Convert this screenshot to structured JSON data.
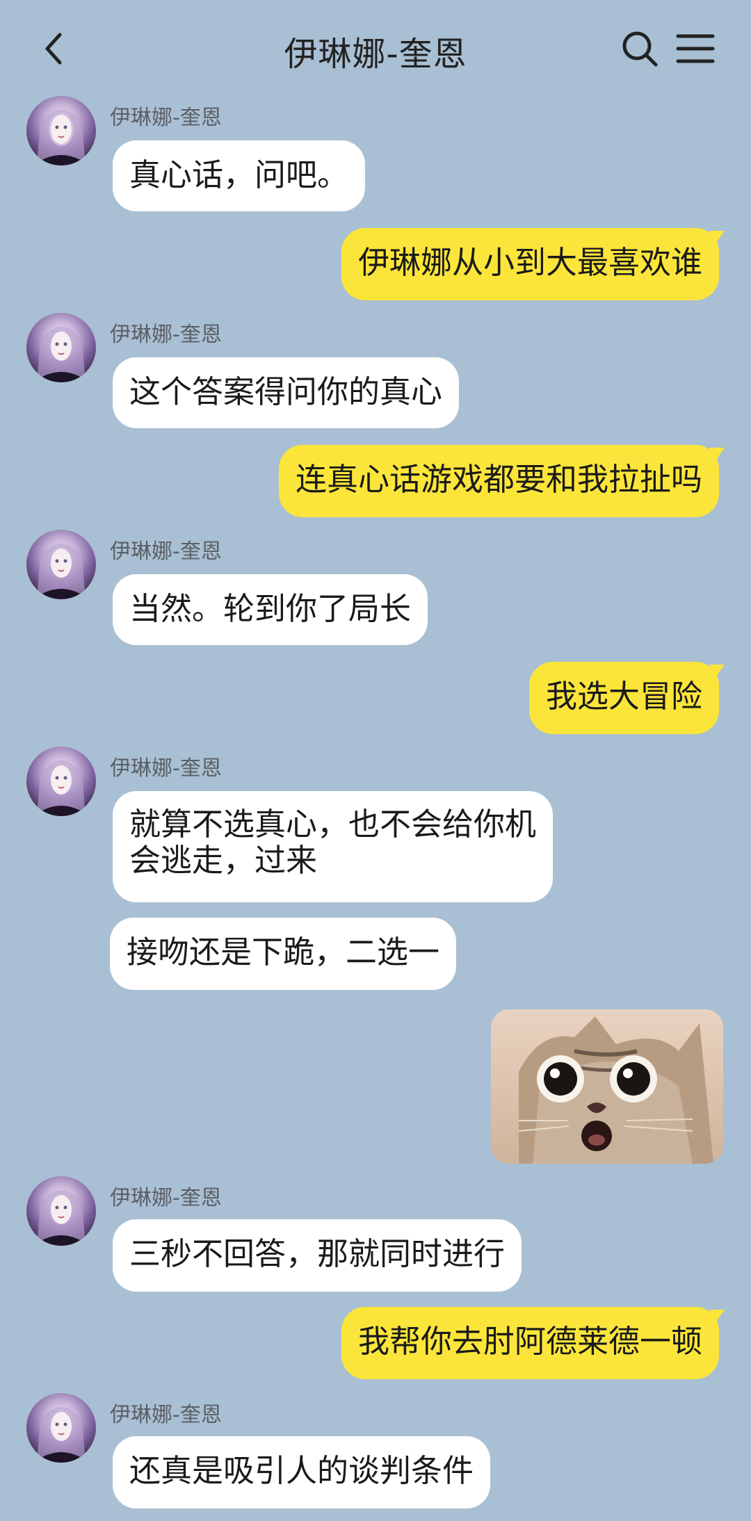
{
  "header": {
    "title": "伊琳娜-奎恩",
    "back_icon": "chevron-left-icon",
    "search_icon": "search-icon",
    "menu_icon": "hamburger-menu-icon"
  },
  "messages": [
    {
      "sender": "伊琳娜-奎恩",
      "text": "真心话，问吧。"
    },
    {
      "text": "伊琳娜从小到大最喜欢谁"
    },
    {
      "sender": "伊琳娜-奎恩",
      "text": "这个答案得问你的真心"
    },
    {
      "text": "连真心话游戏都要和我拉扯吗"
    },
    {
      "sender": "伊琳娜-奎恩",
      "text": "当然。轮到你了局长"
    },
    {
      "text": "我选大冒险"
    },
    {
      "sender": "伊琳娜-奎恩",
      "text_line1": "就算不选真心，也不会给你机",
      "text_line2": "会逃走，过来"
    },
    {
      "text": "接吻还是下跪，二选一"
    },
    {
      "sticker": "shocked-cat-sticker"
    },
    {
      "sender": "伊琳娜-奎恩",
      "text": "三秒不回答，那就同时进行"
    },
    {
      "text": "我帮你去肘阿德莱德一顿"
    },
    {
      "sender": "伊琳娜-奎恩",
      "text": "还真是吸引人的谈判条件"
    }
  ],
  "colors": {
    "background": "#a9bfd3",
    "incoming_bubble": "#ffffff",
    "outgoing_bubble": "#fbe53a"
  }
}
